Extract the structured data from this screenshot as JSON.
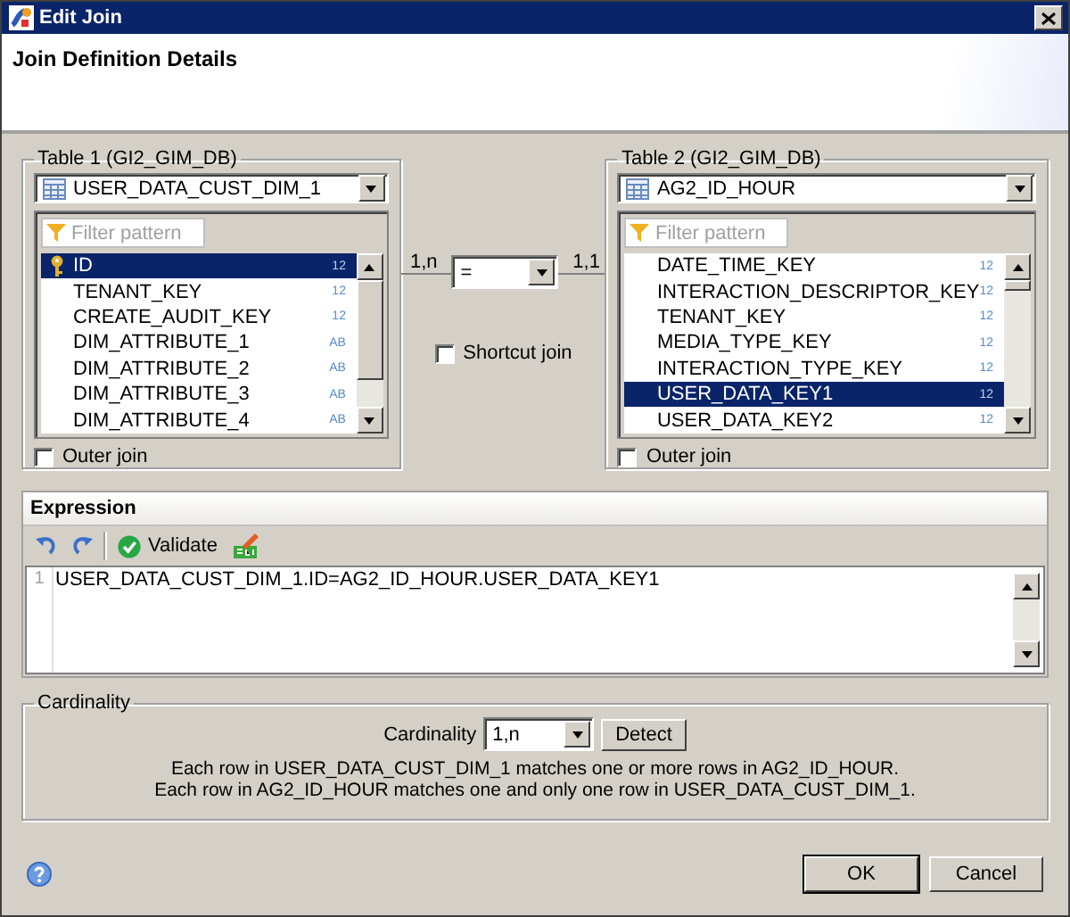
{
  "window": {
    "title": "Edit Join"
  },
  "header": {
    "title": "Join Definition Details"
  },
  "tables": [
    {
      "legend": "Table 1 (GI2_GIM_DB)",
      "table": "USER_DATA_CUST_DIM_1",
      "filter_placeholder": "Filter pattern",
      "outer_join": {
        "label": "Outer join",
        "checked": false
      },
      "columns": [
        {
          "name": "ID",
          "type": "12",
          "kind": "key",
          "selected": true
        },
        {
          "name": "TENANT_KEY",
          "type": "12",
          "kind": "plain",
          "selected": false
        },
        {
          "name": "CREATE_AUDIT_KEY",
          "type": "12",
          "kind": "plain",
          "selected": false
        },
        {
          "name": "DIM_ATTRIBUTE_1",
          "type": "AB",
          "kind": "plain",
          "selected": false
        },
        {
          "name": "DIM_ATTRIBUTE_2",
          "type": "AB",
          "kind": "plain",
          "selected": false
        },
        {
          "name": "DIM_ATTRIBUTE_3",
          "type": "AB",
          "kind": "plain",
          "selected": false
        },
        {
          "name": "DIM_ATTRIBUTE_4",
          "type": "AB",
          "kind": "plain",
          "selected": false
        }
      ]
    },
    {
      "legend": "Table 2 (GI2_GIM_DB)",
      "table": "AG2_ID_HOUR",
      "filter_placeholder": "Filter pattern",
      "outer_join": {
        "label": "Outer join",
        "checked": false
      },
      "columns": [
        {
          "name": "DATE_TIME_KEY",
          "type": "12",
          "kind": "plain",
          "selected": false
        },
        {
          "name": "INTERACTION_DESCRIPTOR_KEY",
          "type": "12",
          "kind": "plain",
          "selected": false
        },
        {
          "name": "TENANT_KEY",
          "type": "12",
          "kind": "plain",
          "selected": false
        },
        {
          "name": "MEDIA_TYPE_KEY",
          "type": "12",
          "kind": "plain",
          "selected": false
        },
        {
          "name": "INTERACTION_TYPE_KEY",
          "type": "12",
          "kind": "plain",
          "selected": false
        },
        {
          "name": "USER_DATA_KEY1",
          "type": "12",
          "kind": "plain",
          "selected": true
        },
        {
          "name": "USER_DATA_KEY2",
          "type": "12",
          "kind": "plain",
          "selected": false
        }
      ]
    }
  ],
  "join": {
    "left_cardinality": "1,n",
    "operator": "=",
    "right_cardinality": "1,1",
    "shortcut": {
      "label": "Shortcut join",
      "checked": false
    }
  },
  "expression": {
    "title": "Expression",
    "validate": "Validate",
    "line_number": "1",
    "text": "USER_DATA_CUST_DIM_1.ID=AG2_ID_HOUR.USER_DATA_KEY1"
  },
  "cardinality": {
    "legend": "Cardinality",
    "label": "Cardinality",
    "value": "1,n",
    "detect": "Detect",
    "lines": [
      "Each row in USER_DATA_CUST_DIM_1 matches one or more rows in AG2_ID_HOUR.",
      "Each row in AG2_ID_HOUR matches one and only one row in USER_DATA_CUST_DIM_1."
    ]
  },
  "buttons": [
    {
      "label": "OK",
      "selected": true
    },
    {
      "label": "Cancel",
      "selected": false
    }
  ]
}
